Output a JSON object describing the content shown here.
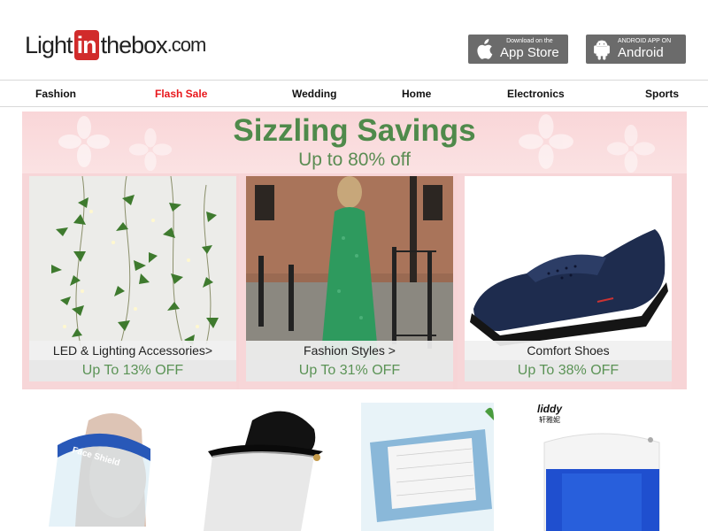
{
  "header": {
    "logo": {
      "part1": "Light",
      "part2": "in",
      "part3": "thebox",
      "part4": ".com"
    },
    "app_store": {
      "small": "Download on the",
      "big": "App Store"
    },
    "android": {
      "small": "ANDROID APP ON",
      "big": "Android"
    }
  },
  "nav": {
    "items": [
      "Fashion",
      "Flash Sale",
      "Wedding",
      "Home",
      "Electronics",
      "Sports"
    ]
  },
  "banner": {
    "title": "Sizzling Savings",
    "subtitle": "Up to 80% off",
    "cards": [
      {
        "label": "LED & Lighting Accessories>",
        "discount": "Up To 13% OFF"
      },
      {
        "label": "Fashion Styles >",
        "discount": "Up To 31% OFF"
      },
      {
        "label": "Comfort Shoes",
        "discount": "Up To 38% OFF"
      }
    ]
  },
  "products": {
    "face_shield_text": "Face Shield",
    "liddy_brand": "liddy",
    "liddy_cn": "轩雅妮"
  },
  "colors": {
    "accent_red": "#e8171c",
    "banner_green": "#4f8a4b",
    "banner_pink": "#f7d4d6"
  }
}
